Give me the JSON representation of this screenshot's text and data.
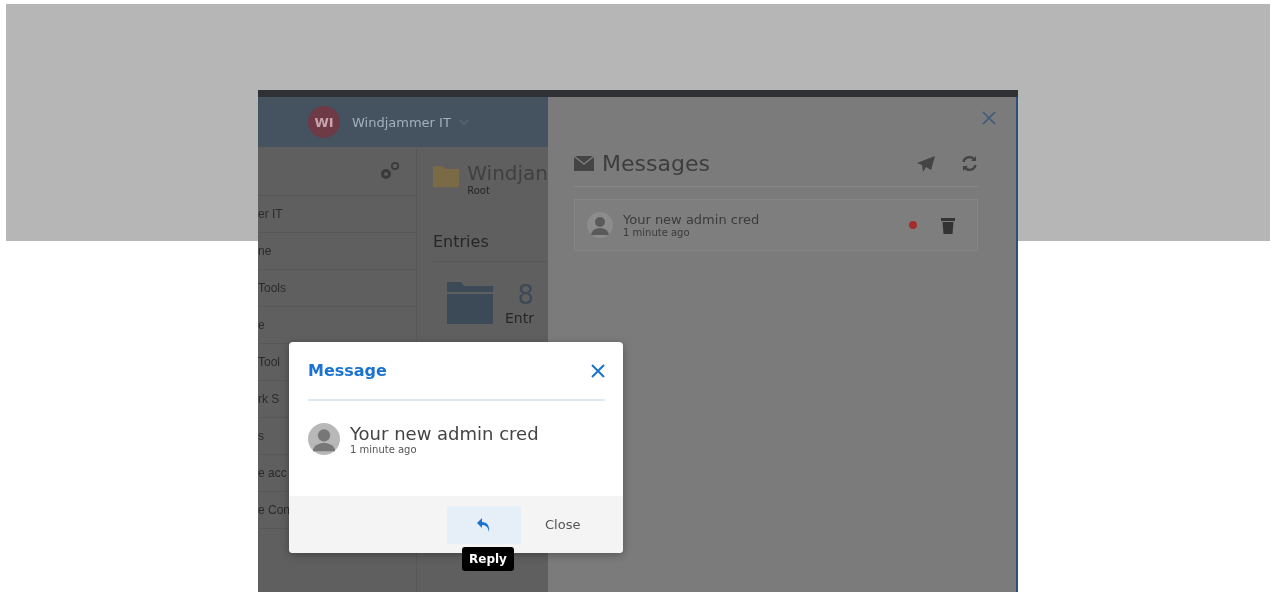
{
  "app_header": {
    "avatar_initials": "WI",
    "org_name": "Windjammer IT"
  },
  "sidebar": {
    "items": [
      "er IT",
      "ne",
      "Tools",
      "e",
      "Tool",
      "rk S",
      "s",
      "e acc",
      "e Con"
    ]
  },
  "main": {
    "title": "Windjan",
    "subtitle": "Root",
    "section": "Entries",
    "count": "8",
    "count_label": "Entr"
  },
  "messages_panel": {
    "title": "Messages",
    "messages": [
      {
        "subject": "Your new admin cred",
        "time": "1 minute ago",
        "unread": true
      }
    ]
  },
  "dialog": {
    "title": "Message",
    "subject": "Your new admin cred",
    "time": "1 minute ago",
    "reply_tooltip": "Reply",
    "close_label": "Close"
  }
}
